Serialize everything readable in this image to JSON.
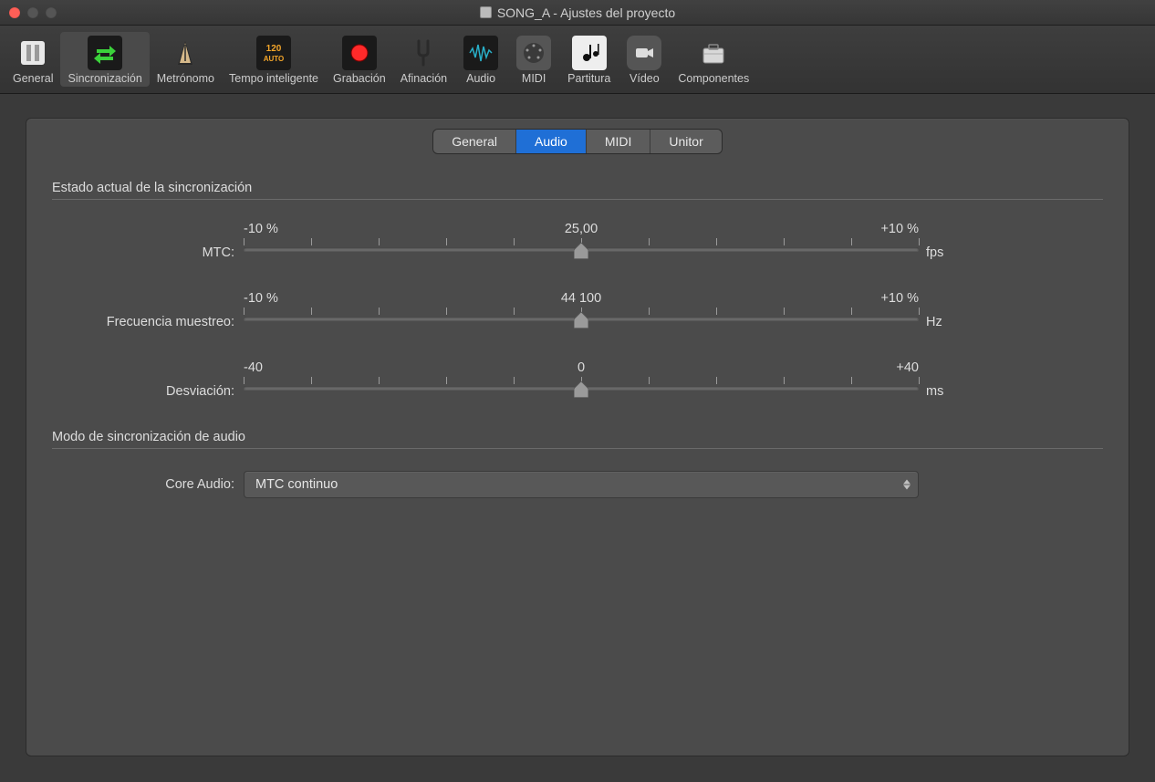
{
  "window": {
    "title": "SONG_A - Ajustes del proyecto"
  },
  "toolbar": [
    {
      "id": "general",
      "label": "General"
    },
    {
      "id": "sync",
      "label": "Sincronización",
      "active": true
    },
    {
      "id": "metronome",
      "label": "Metrónomo"
    },
    {
      "id": "smarttempo",
      "label": "Tempo inteligente"
    },
    {
      "id": "record",
      "label": "Grabación"
    },
    {
      "id": "tuning",
      "label": "Afinación"
    },
    {
      "id": "audio",
      "label": "Audio"
    },
    {
      "id": "midi",
      "label": "MIDI"
    },
    {
      "id": "score",
      "label": "Partitura"
    },
    {
      "id": "video",
      "label": "Vídeo"
    },
    {
      "id": "components",
      "label": "Componentes"
    }
  ],
  "tabs": {
    "items": [
      {
        "id": "general",
        "label": "General"
      },
      {
        "id": "audio",
        "label": "Audio",
        "selected": true
      },
      {
        "id": "midi",
        "label": "MIDI"
      },
      {
        "id": "unitor",
        "label": "Unitor"
      }
    ]
  },
  "section1": {
    "title": "Estado actual de la sincronización",
    "sliders": [
      {
        "id": "mtc",
        "label": "MTC:",
        "left": "-10 %",
        "center": "25,00",
        "right": "+10 %",
        "unit": "fps"
      },
      {
        "id": "samplerate",
        "label": "Frecuencia muestreo:",
        "left": "-10 %",
        "center": "44 100",
        "right": "+10 %",
        "unit": "Hz"
      },
      {
        "id": "deviation",
        "label": "Desviación:",
        "left": "-40",
        "center": "0",
        "right": "+40",
        "unit": "ms"
      }
    ]
  },
  "section2": {
    "title": "Modo de sincronización de audio",
    "coreaudio_label": "Core Audio:",
    "coreaudio_value": "MTC continuo"
  }
}
